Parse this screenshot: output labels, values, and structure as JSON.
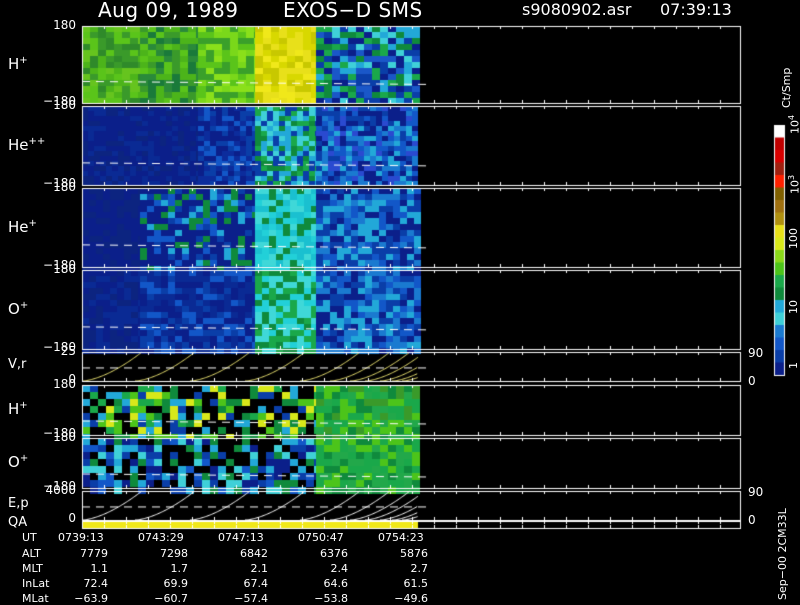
{
  "header": {
    "date": "Aug 09, 1989",
    "instrument": "EXOS−D SMS",
    "file": "s9080902.asr",
    "time": "07:39:13"
  },
  "panels": [
    {
      "id": "hplus",
      "label": "H",
      "sup": "+",
      "ymax": "180",
      "ymin": "−180",
      "kind": "spec"
    },
    {
      "id": "hepp",
      "label": "He",
      "sup": "++",
      "ymax": "180",
      "ymin": "−180",
      "kind": "spec"
    },
    {
      "id": "hep",
      "label": "He",
      "sup": "+",
      "ymax": "180",
      "ymin": "−180",
      "kind": "spec"
    },
    {
      "id": "oplus",
      "label": "O",
      "sup": "+",
      "ymax": "180",
      "ymin": "−180",
      "kind": "spec"
    },
    {
      "id": "vr",
      "label": "V,r",
      "sup": "",
      "ymax": "25",
      "ymin": "0",
      "kind": "line",
      "right_max": "90",
      "right_min": "0"
    },
    {
      "id": "hplus2",
      "label": "H",
      "sup": "+",
      "ymax": "180",
      "ymin": "−180",
      "kind": "spec2"
    },
    {
      "id": "oplus2",
      "label": "O",
      "sup": "+",
      "ymax": "180",
      "ymin": "−180",
      "kind": "spec2"
    },
    {
      "id": "ep",
      "label": "E,p",
      "sup": "",
      "ymax": "4000",
      "ymin": "0",
      "kind": "line",
      "right_max": "90",
      "right_min": "0"
    },
    {
      "id": "qa",
      "label": "QA",
      "sup": "",
      "ymax": "",
      "ymin": "",
      "kind": "qa"
    }
  ],
  "colorbar": {
    "unit": "Ct/Smp",
    "ticks": [
      {
        "v": "10",
        "sup": "4"
      },
      {
        "v": "10",
        "sup": "3"
      },
      {
        "v": "100",
        "sup": ""
      },
      {
        "v": "10",
        "sup": ""
      },
      {
        "v": "1",
        "sup": ""
      }
    ]
  },
  "footer_note": "Sep−00 2CM33L",
  "table": {
    "row_labels": [
      "UT",
      "ALT",
      "MLT",
      "InLat",
      "MLat"
    ],
    "columns": [
      [
        "0739:13",
        "7779",
        "1.1",
        "72.4",
        "−63.9"
      ],
      [
        "0743:29",
        "7298",
        "1.7",
        "69.9",
        "−60.7"
      ],
      [
        "0747:13",
        "6842",
        "2.1",
        "67.4",
        "−57.4"
      ],
      [
        "0750:47",
        "6376",
        "2.4",
        "64.6",
        "−53.8"
      ],
      [
        "0754:23",
        "5876",
        "2.7",
        "61.5",
        "−49.6"
      ]
    ]
  },
  "chart_data": {
    "type": "heatmap",
    "title": "Aug 09, 1989   EXOS−D SMS",
    "x_ticks": [
      "0739:13",
      "0743:29",
      "0747:13",
      "0750:47",
      "0754:23"
    ],
    "series": [
      {
        "name": "H+",
        "ylim": [
          -180,
          180
        ]
      },
      {
        "name": "He++",
        "ylim": [
          -180,
          180
        ]
      },
      {
        "name": "He+",
        "ylim": [
          -180,
          180
        ]
      },
      {
        "name": "O+",
        "ylim": [
          -180,
          180
        ]
      },
      {
        "name": "V,r",
        "ylim": [
          0,
          25
        ]
      },
      {
        "name": "H+",
        "ylim": [
          -180,
          180
        ]
      },
      {
        "name": "O+",
        "ylim": [
          -180,
          180
        ]
      },
      {
        "name": "E,p",
        "ylim": [
          0,
          4000
        ]
      },
      {
        "name": "QA"
      }
    ],
    "color_scale": [
      "1",
      "10",
      "100",
      "10^3",
      "10^4"
    ],
    "color_unit": "Ct/Smp"
  }
}
